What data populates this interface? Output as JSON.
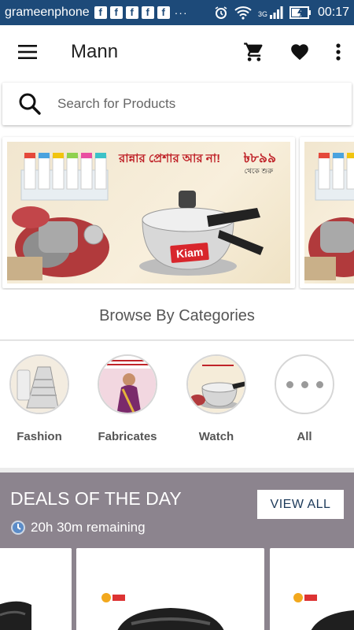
{
  "status_bar": {
    "carrier": "grameenphone",
    "notification_icons": [
      "f",
      "f",
      "f",
      "f",
      "f"
    ],
    "overflow": "···",
    "network": "3G",
    "time": "00:17"
  },
  "app_bar": {
    "title": "Mann",
    "icons": [
      "menu-icon",
      "cart-icon",
      "heart-icon",
      "more-vert-icon"
    ]
  },
  "search": {
    "placeholder": "Search for Products"
  },
  "banner": {
    "headline": "রান্নার প্রেশার আর না!",
    "price": "৳৮৯৯",
    "price_note": "থেকে শুরু",
    "brand": "Kiam"
  },
  "categories": {
    "heading": "Browse By Categories",
    "items": [
      {
        "label": "Fashion"
      },
      {
        "label": "Fabricates"
      },
      {
        "label": "Watch"
      },
      {
        "label": "All"
      }
    ]
  },
  "deals": {
    "title": "DEALS OF THE DAY",
    "view_all": "VIEW ALL",
    "remaining": "20h 30m remaining"
  },
  "colors": {
    "status_bar": "#1d4a79",
    "deals_bg": "#8c848e",
    "accent_red": "#c0242a"
  }
}
